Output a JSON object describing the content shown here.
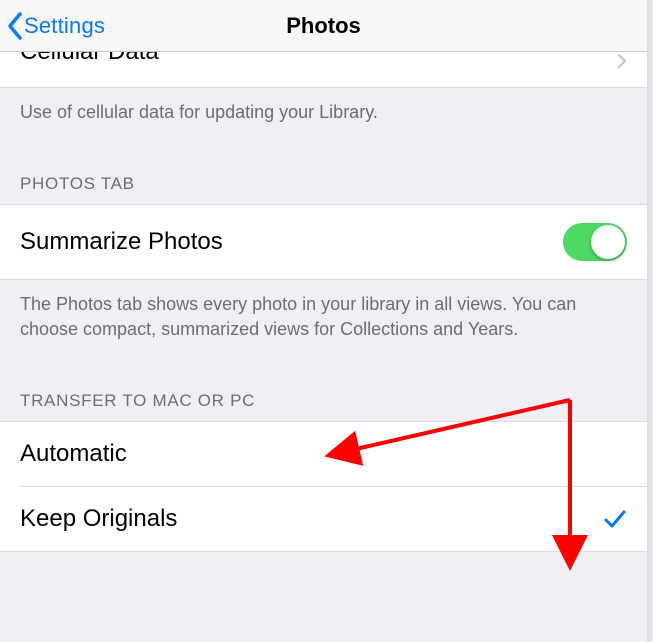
{
  "header": {
    "back_label": "Settings",
    "title": "Photos"
  },
  "cellular": {
    "row_label": "Cellular Data",
    "footer": "Use of cellular data for updating your Library."
  },
  "photos_tab": {
    "header": "PHOTOS TAB",
    "row_label": "Summarize Photos",
    "toggle_on": true,
    "footer": "The Photos tab shows every photo in your library in all views. You can choose compact, summarized views for Collections and Years."
  },
  "transfer": {
    "header": "TRANSFER TO MAC OR PC",
    "options": [
      {
        "label": "Automatic",
        "selected": false
      },
      {
        "label": "Keep Originals",
        "selected": true
      }
    ]
  },
  "colors": {
    "ios_blue": "#057aff",
    "ios_green": "#4cd964",
    "annotation_red": "#ff0000"
  }
}
